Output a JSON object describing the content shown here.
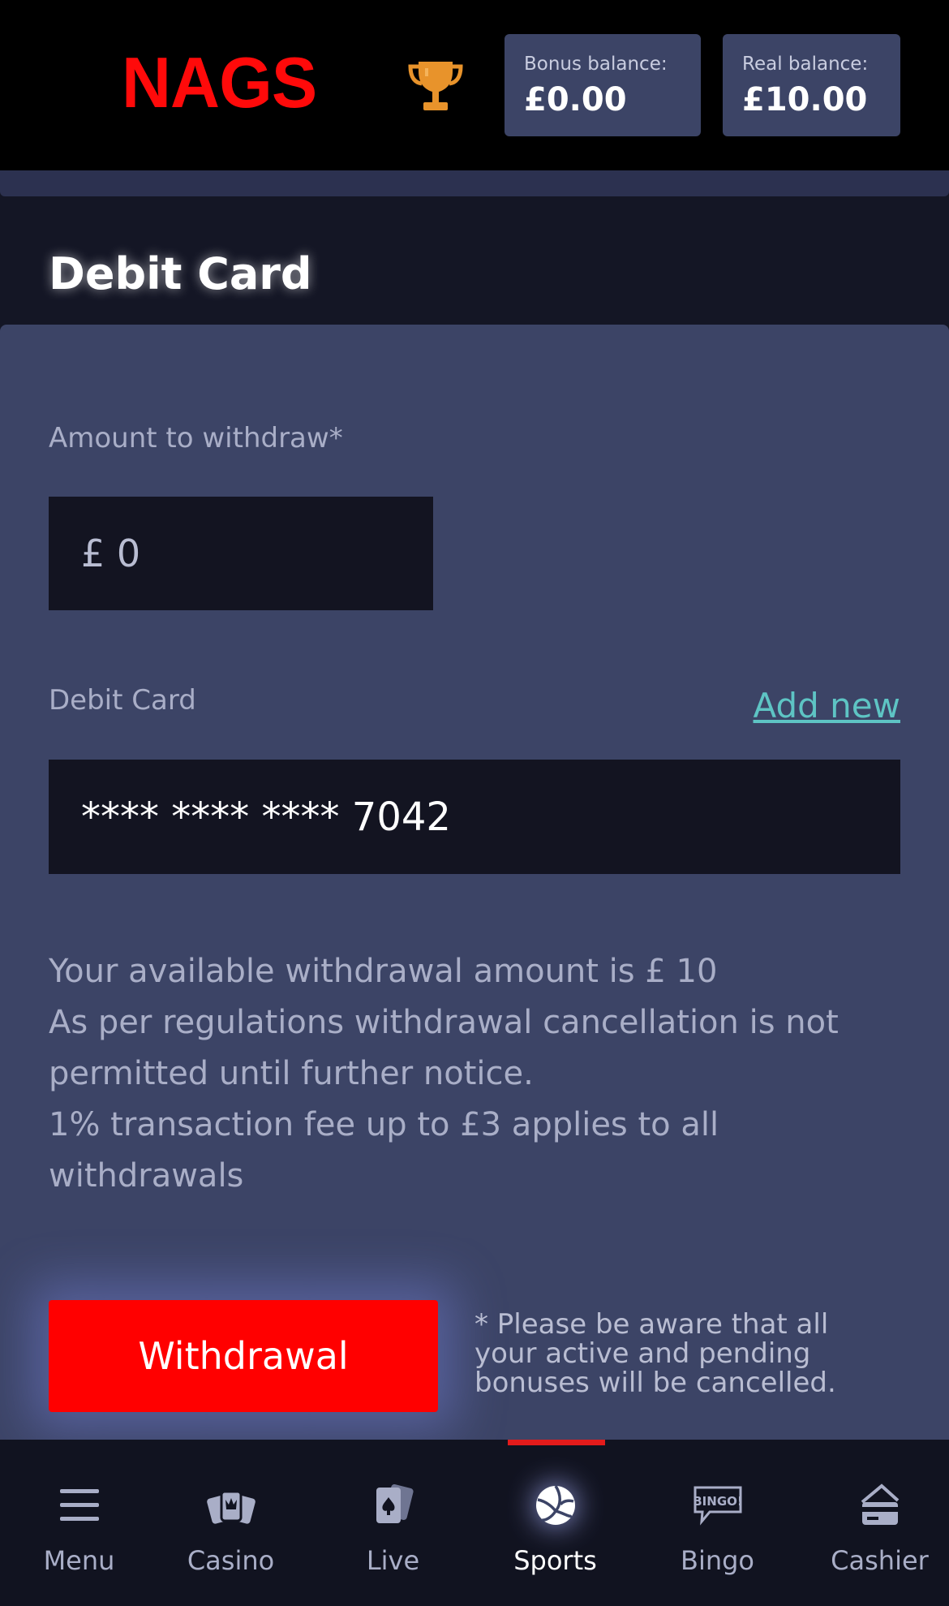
{
  "header": {
    "logo_text": "NAGS",
    "trophy_icon": "trophy-icon",
    "bonus_balance_label": "Bonus balance:",
    "bonus_balance_value": "£0.00",
    "real_balance_label": "Real balance:",
    "real_balance_value": "£10.00"
  },
  "page": {
    "title": "Debit Card"
  },
  "form": {
    "amount_label": "Amount to withdraw*",
    "amount_value": "£ 0",
    "card_label": "Debit Card",
    "add_new_label": "Add new",
    "card_value": "**** **** **** 7042",
    "info_lines": [
      "Your available withdrawal amount is £ 10",
      "As per regulations withdrawal cancellation is not permitted until further notice.",
      "1% transaction fee up to £3 applies to all withdrawals"
    ],
    "withdraw_button": "Withdrawal",
    "notice": "* Please be aware that all your active and pending bonuses will be cancelled."
  },
  "nav": {
    "active": "Sports",
    "items": [
      {
        "label": "Menu",
        "icon": "menu-icon"
      },
      {
        "label": "Casino",
        "icon": "casino-icon"
      },
      {
        "label": "Live",
        "icon": "live-cards-icon"
      },
      {
        "label": "Sports",
        "icon": "sports-ball-icon"
      },
      {
        "label": "Bingo",
        "icon": "bingo-icon"
      },
      {
        "label": "Cashier",
        "icon": "cashier-icon"
      }
    ]
  },
  "colors": {
    "accent_red": "#ff0000",
    "link_teal": "#5ec4c4",
    "panel": "#3c4466",
    "trophy_gold": "#e8932b"
  }
}
